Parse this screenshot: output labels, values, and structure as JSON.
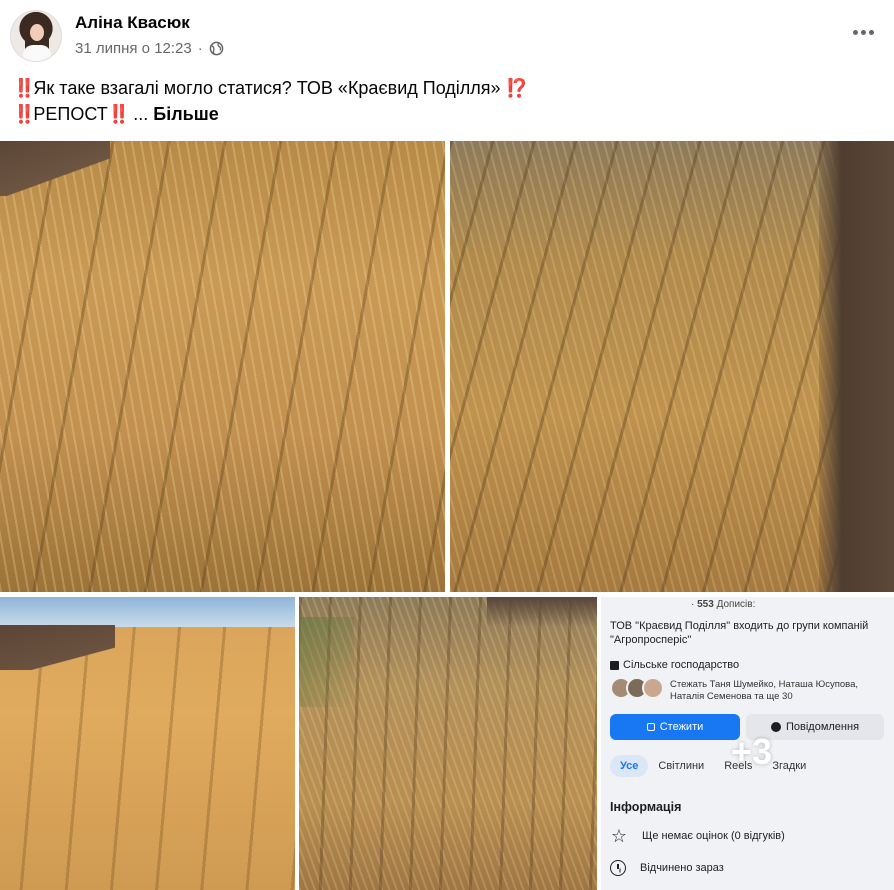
{
  "post": {
    "author": "Аліна Квасюк",
    "timestamp": "31 липня о 12:23",
    "separator": "·",
    "text_line1_bangs": "‼️",
    "text_line1": "Як таке взагалі могло статися? ТОВ «Краєвид Поділля»",
    "text_line1_end": "⁉️",
    "text_line2_bangs_start": "‼️",
    "text_line2": "РЕПОСТ",
    "text_line2_bangs_end": "‼️",
    "ellipsis": "...",
    "more_link": "Більше"
  },
  "icons": {
    "privacy": "globe-icon",
    "menu": "more-options-icon"
  },
  "photos": {
    "more_count": "+3",
    "screenshot": {
      "followers_line_count": "553",
      "followers_line_label": "Дописів:",
      "dot": "·",
      "description": "ТОВ \"Краєвид Поділля\" входить до групи компаній \"Агропросперіс\"",
      "category": "Сільське господарство",
      "friends_follow": "Стежать Таня Шумейко, Наташа Юсупова, Наталія Семенова та ще 30",
      "follow_button": "Стежити",
      "message_button": "Повідомлення",
      "tabs": [
        "Усе",
        "Світлини",
        "Reels",
        "Згадки"
      ],
      "info_title": "Інформація",
      "rating": "Ще немає оцінок (0 відгуків)",
      "hours": "Відчинено зараз"
    }
  },
  "colors": {
    "primary_blue": "#1877f2",
    "secondary_text": "#65676b",
    "alert_red": "#e0245e"
  }
}
